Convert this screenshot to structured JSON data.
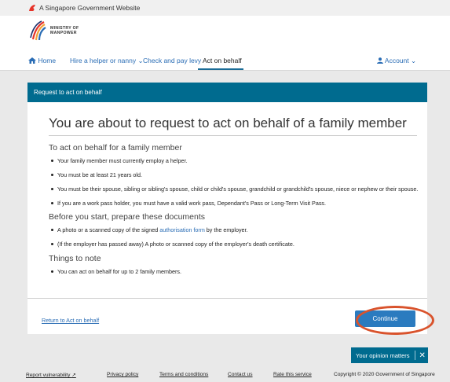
{
  "gov_banner": {
    "text": "A Singapore Government Website"
  },
  "logo": {
    "line1": "MINISTRY OF",
    "line2": "MANPOWER"
  },
  "nav": {
    "home": "Home",
    "hire": "Hire a helper or nanny",
    "levy": "Check and pay levy",
    "act": "Act on behalf",
    "account": "Account"
  },
  "card": {
    "header": "Request to act on behalf",
    "title": "You are about to request to act on behalf of a family member",
    "sections": [
      {
        "heading": "To act on behalf for a family member",
        "items": [
          "Your family member must currently employ a helper.",
          "You must be at least 21 years old.",
          "You must be their spouse, sibling or sibling's spouse, child or child's spouse, grandchild or grandchild's spouse, niece or nephew or their spouse.",
          "If you are a work pass holder, you must have a valid work pass, Dependant's Pass or Long-Term Visit Pass."
        ]
      },
      {
        "heading": "Before you start, prepare these documents",
        "item1_pre": "A photo or a scanned copy of the signed ",
        "item1_link": "authorisation form",
        "item1_post": " by the employer.",
        "item2": "(If the employer has passed away) A photo or scanned copy of the employer's death certificate."
      },
      {
        "heading": "Things to note",
        "items": [
          "You can act on behalf for up to 2 family members."
        ]
      }
    ],
    "return_link": "Return to Act on behalf",
    "continue": "Continue"
  },
  "opinion": {
    "label": "Your opinion matters",
    "close": "✕"
  },
  "footer": {
    "vuln": "Report vulnerability",
    "privacy": "Privacy policy",
    "terms": "Terms and conditions",
    "contact": "Contact us",
    "rate": "Rate this service",
    "copyright": "Copyright © 2020 Government of Singapore"
  },
  "colors": {
    "accent": "#006b8f",
    "button": "#2b7bbf",
    "link": "#2a6db5",
    "highlight_ring": "#d9532c"
  }
}
